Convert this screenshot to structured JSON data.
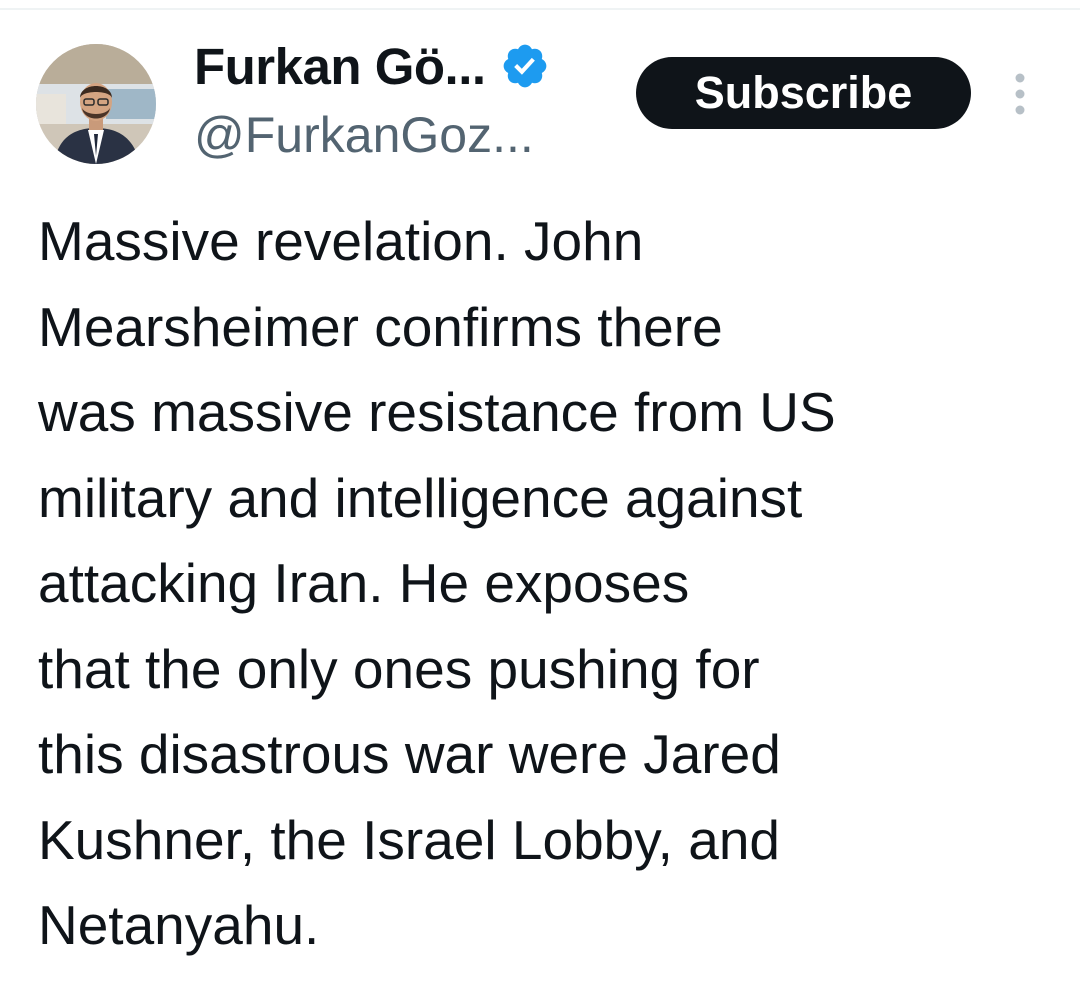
{
  "author": {
    "display_name": "Furkan Gö...",
    "handle": "@FurkanGoz...",
    "verified_icon": "verified-badge-icon",
    "verified_color": "#1d9bf0"
  },
  "actions": {
    "subscribe_label": "Subscribe",
    "subscribe_bg": "#0f1419",
    "more_icon": "more-vertical-icon"
  },
  "tweet": {
    "lines": [
      "Massive revelation. John",
      "Mearsheimer confirms there",
      "was massive resistance from US",
      "military and intelligence against",
      "attacking Iran. He exposes",
      "that the only ones pushing for",
      "this disastrous war were Jared",
      "Kushner, the Israel Lobby, and",
      "Netanyahu."
    ]
  }
}
